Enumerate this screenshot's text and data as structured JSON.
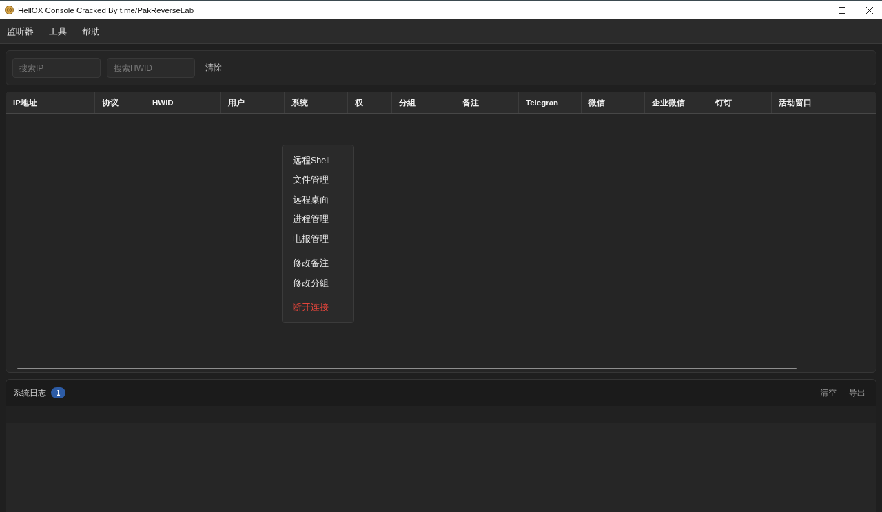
{
  "window": {
    "title": "HellOX Console Cracked By t.me/PakReverseLab"
  },
  "menu_bar": [
    "监听器",
    "工具",
    "帮助"
  ],
  "search": {
    "fields": [
      {
        "placeholder": "搜索IP"
      },
      {
        "placeholder": "搜索HWID"
      }
    ],
    "clear_button": "清除"
  },
  "table": {
    "columns": [
      "IP地址",
      "协议",
      "HWID",
      "用户",
      "系统",
      "权",
      "分組",
      "备注",
      "Telegran",
      "微信",
      "企业微信",
      "钉钉",
      "活动窗口"
    ]
  },
  "context_menu": {
    "items": [
      {
        "kind": "item",
        "label": "远程Shell"
      },
      {
        "kind": "item",
        "label": "文件管理"
      },
      {
        "kind": "item",
        "label": "远程桌面"
      },
      {
        "kind": "item",
        "label": "进程管理"
      },
      {
        "kind": "item",
        "label": "电报管理"
      },
      {
        "kind": "separator"
      },
      {
        "kind": "item",
        "label": "修改备注"
      },
      {
        "kind": "item",
        "label": "修改分組"
      },
      {
        "kind": "separator"
      },
      {
        "kind": "danger",
        "label": "断开连接"
      }
    ]
  },
  "log_panel": {
    "title": "系统日志",
    "badge": "1",
    "buttons": [
      "清空",
      "导出"
    ]
  }
}
